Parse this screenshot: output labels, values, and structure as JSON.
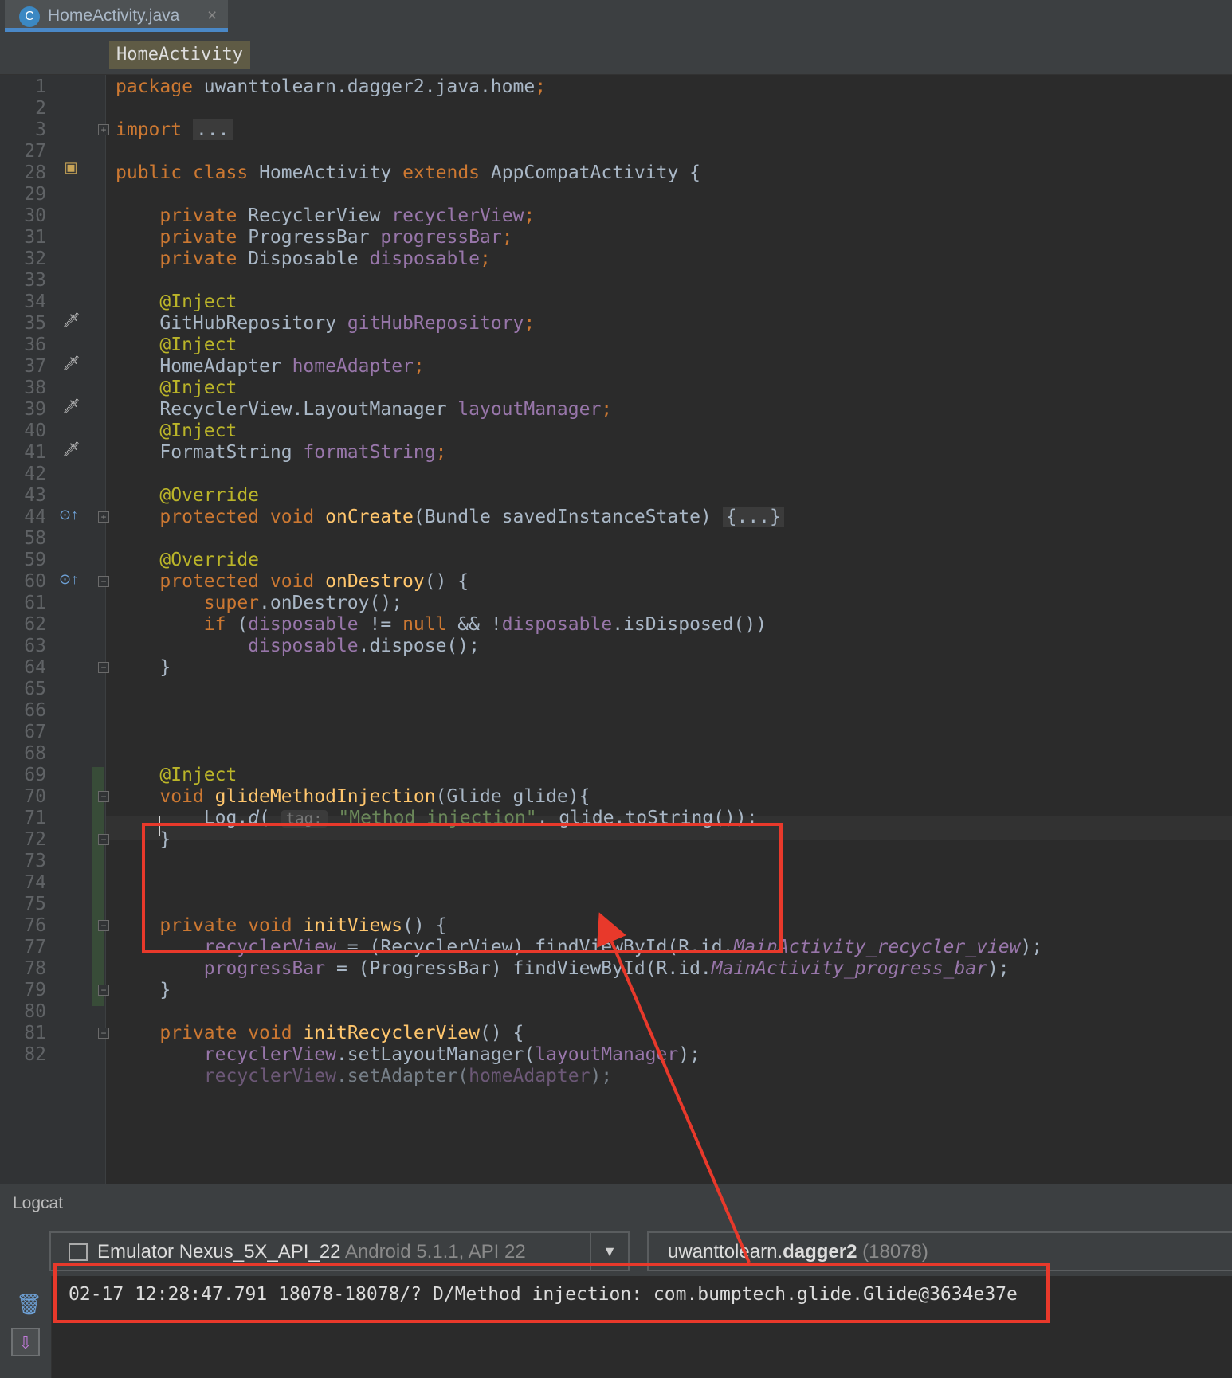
{
  "tab": {
    "icon": "class-icon",
    "icon_letter": "C",
    "label": "HomeActivity.java",
    "close": "×"
  },
  "breadcrumb": "HomeActivity",
  "lines": {
    "l1": "1",
    "l2": "2",
    "l3": "3",
    "l27": "27",
    "l28": "28",
    "l29": "29",
    "l30": "30",
    "l31": "31",
    "l32": "32",
    "l33": "33",
    "l34": "34",
    "l35": "35",
    "l36": "36",
    "l37": "37",
    "l38": "38",
    "l39": "39",
    "l40": "40",
    "l41": "41",
    "l42": "42",
    "l43": "43",
    "l44": "44",
    "l58": "58",
    "l59": "59",
    "l60": "60",
    "l61": "61",
    "l62": "62",
    "l63": "63",
    "l64": "64",
    "l65": "65",
    "l66": "66",
    "l67": "67",
    "l68": "68",
    "l69": "69",
    "l70": "70",
    "l71": "71",
    "l72": "72",
    "l73": "73",
    "l74": "74",
    "l75": "75",
    "l76": "76",
    "l77": "77",
    "l78": "78",
    "l79": "79",
    "l80": "80",
    "l81": "81",
    "l82": "82"
  },
  "code": {
    "package_kw": "package",
    "package_name": " uwanttolearn.dagger2.java.home",
    "import_kw": "import",
    "import_fold": "...",
    "public": "public",
    "class": "class",
    "class_name": "HomeActivity",
    "extends": "extends",
    "super_class": "AppCompatActivity",
    "private": "private",
    "protected": "protected",
    "void": "void",
    "super": "super",
    "if": "if",
    "null": "null",
    "t_recycler": "RecyclerView",
    "f_recycler": "recyclerView",
    "t_progress": "ProgressBar",
    "f_progress": "progressBar",
    "t_disposable": "Disposable",
    "f_disposable": "disposable",
    "inject": "@Inject",
    "override": "@Override",
    "t_repo": "GitHubRepository",
    "f_repo": "gitHubRepository",
    "t_adapter": "HomeAdapter",
    "f_adapter": "homeAdapter",
    "t_layout": "RecyclerView.LayoutManager",
    "f_layout": "layoutManager",
    "t_format": "FormatString",
    "f_format": "formatString",
    "m_oncreate": "onCreate",
    "oncreate_params": "(Bundle savedInstanceState) ",
    "oncreate_fold": "{...}",
    "m_ondestroy": "onDestroy",
    "super_call": ".onDestroy();",
    "if_tail_1": " != ",
    "if_tail_2": " && !",
    "if_tail_3": ".isDisposed())",
    "dispose_call": ".dispose();",
    "m_glide": "glideMethodInjection",
    "glide_params": "(Glide glide){",
    "log_call": "Log.",
    "log_d": "d",
    "log_open": "(",
    "hint_tag": "tag:",
    "log_str": "\"Method injection\"",
    "log_tail": ", glide.toString());",
    "m_initviews": "initViews",
    "m_initrecycler": "initRecyclerView",
    "cast_recycler": " = (RecyclerView) findViewById(R.id.",
    "id_recycler": "MainActivity_recycler_view",
    "cast_progress": " = (ProgressBar) findViewById(R.id.",
    "id_progress": "MainActivity_progress_bar",
    "set_layout": ".setLayoutManager(",
    "set_adapter": ".setAdapter(",
    "semi": ";",
    "paren_close": ");",
    "brace_open": " {",
    "brace_close": "}",
    "empty_parens": "()"
  },
  "logcat": {
    "title": "Logcat",
    "device": "Emulator Nexus_5X_API_22",
    "device_detail": " Android 5.1.1, API 22",
    "process_pre": "uwanttolearn.",
    "process_bold": "dagger2",
    "process_pid": " (18078)",
    "entry": "02-17 12:28:47.791 18078-18078/? D/Method injection: com.bumptech.glide.Glide@3634e37e"
  },
  "icons": {
    "trash": "trash-icon",
    "scroll": "scroll-to-end-icon",
    "dropdown": "chevron-down-icon",
    "dagger": "dagger-injection-icon",
    "override": "override-method-icon",
    "android_class": "android-class-icon"
  },
  "colors": {
    "accent_red": "#e8392b",
    "keyword": "#cc7832",
    "field": "#9876aa",
    "annotation": "#bbb529",
    "string": "#6a8759",
    "method": "#ffc66d"
  }
}
